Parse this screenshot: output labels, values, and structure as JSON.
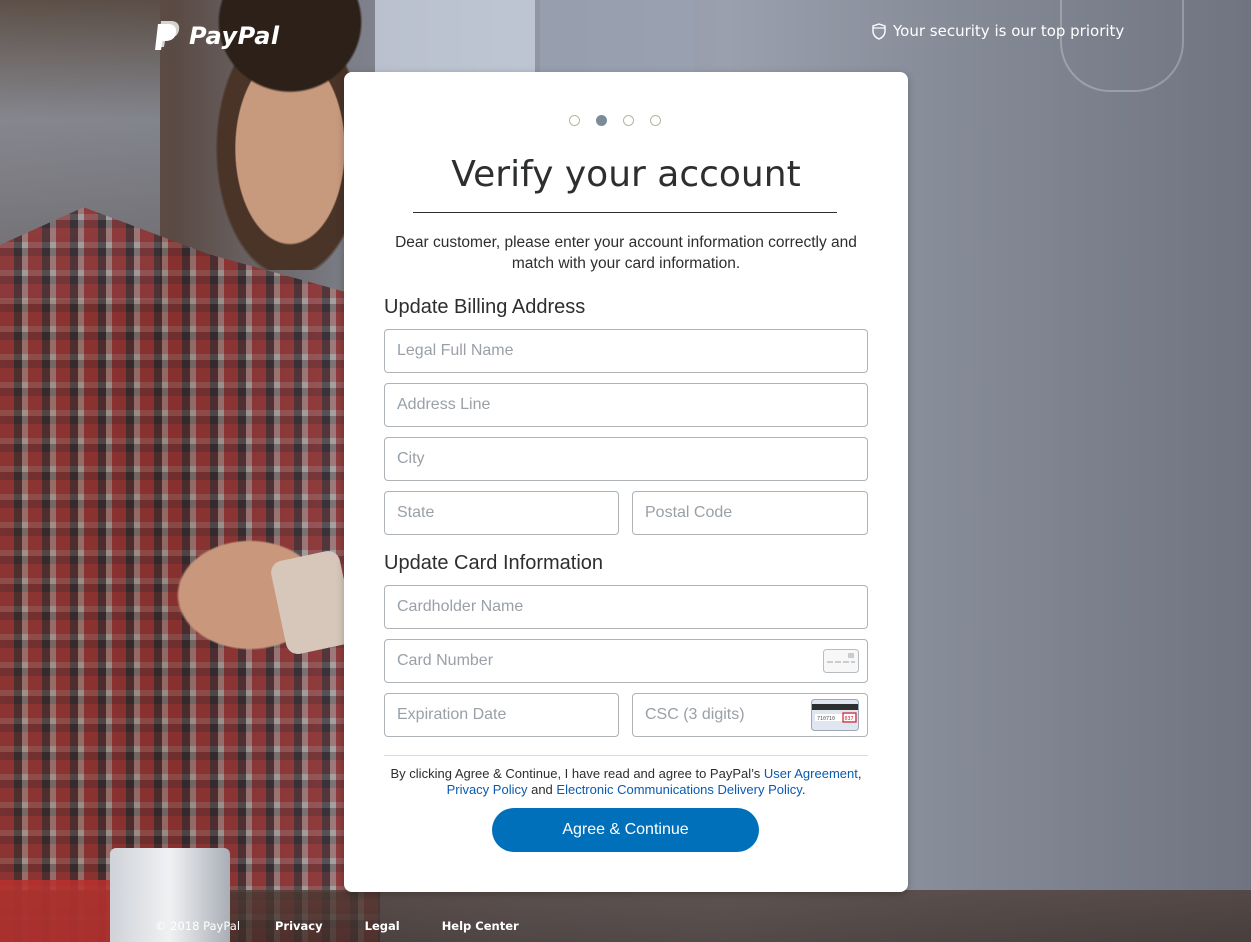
{
  "brand": {
    "logo_text": "PayPal",
    "logo_icon": "paypal-p-icon",
    "white": "#ffffff"
  },
  "header": {
    "security_text": "Your security is our top priority",
    "security_icon": "shield-icon"
  },
  "progress": {
    "total_steps": 4,
    "current_step": 2
  },
  "form": {
    "title": "Verify your account",
    "intro": "Dear customer, please enter your account information correctly and match with your card information.",
    "billing": {
      "heading": "Update Billing Address",
      "full_name_placeholder": "Legal Full Name",
      "address_placeholder": "Address Line",
      "city_placeholder": "City",
      "state_placeholder": "State",
      "postal_placeholder": "Postal Code"
    },
    "card": {
      "heading": "Update Card Information",
      "holder_placeholder": "Cardholder Name",
      "number_placeholder": "Card Number",
      "number_icon": "credit-card-icon",
      "expiry_placeholder": "Expiration Date",
      "csc_placeholder": "CSC (3 digits)",
      "csc_icon": "csc-card-back-icon"
    },
    "legal": {
      "prefix": "By clicking Agree & Continue, I have read and agree to PayPal’s ",
      "user_agreement": "User Agreement",
      "comma": ", ",
      "privacy_policy": "Privacy Policy",
      "and": " and ",
      "ecdp": "Electronic Communications Delivery Policy",
      "suffix": "."
    },
    "submit_label": "Agree & Continue",
    "submit_color": "#0070ba",
    "link_color": "#0a5ab0"
  },
  "footer": {
    "copyright": "© 2018 PayPal",
    "links": [
      "Privacy",
      "Legal",
      "Help Center"
    ]
  }
}
